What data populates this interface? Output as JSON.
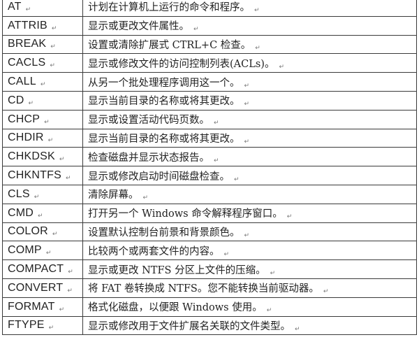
{
  "table": {
    "paragraph_mark": "↵",
    "rows": [
      {
        "command": "AT",
        "description": "计划在计算机上运行的命令和程序。"
      },
      {
        "command": "ATTRIB",
        "description": "显示或更改文件属性。"
      },
      {
        "command": "BREAK",
        "description": "设置或清除扩展式 CTRL+C 检查。"
      },
      {
        "command": "CACLS",
        "description": "显示或修改文件的访问控制列表(ACLs)。"
      },
      {
        "command": "CALL",
        "description": "从另一个批处理程序调用这一个。"
      },
      {
        "command": "CD",
        "description": "显示当前目录的名称或将其更改。"
      },
      {
        "command": "CHCP",
        "description": "显示或设置活动代码页数。"
      },
      {
        "command": "CHDIR",
        "description": "显示当前目录的名称或将其更改。"
      },
      {
        "command": "CHKDSK",
        "description": "检查磁盘并显示状态报告。"
      },
      {
        "command": "CHKNTFS",
        "description": "显示或修改启动时间磁盘检查。"
      },
      {
        "command": "CLS",
        "description": "清除屏幕。"
      },
      {
        "command": "CMD",
        "description": "打开另一个 Windows 命令解释程序窗口。"
      },
      {
        "command": "COLOR",
        "description": "设置默认控制台前景和背景颜色。"
      },
      {
        "command": "COMP",
        "description": "比较两个或两套文件的内容。"
      },
      {
        "command": "COMPACT",
        "description": "显示或更改 NTFS 分区上文件的压缩。"
      },
      {
        "command": "CONVERT",
        "description": "将 FAT 卷转换成 NTFS。您不能转换当前驱动器。"
      },
      {
        "command": "FORMAT",
        "description": "格式化磁盘，以便跟 Windows 使用。"
      },
      {
        "command": "FTYPE",
        "description": "显示或修改用于文件扩展名关联的文件类型。"
      }
    ]
  }
}
